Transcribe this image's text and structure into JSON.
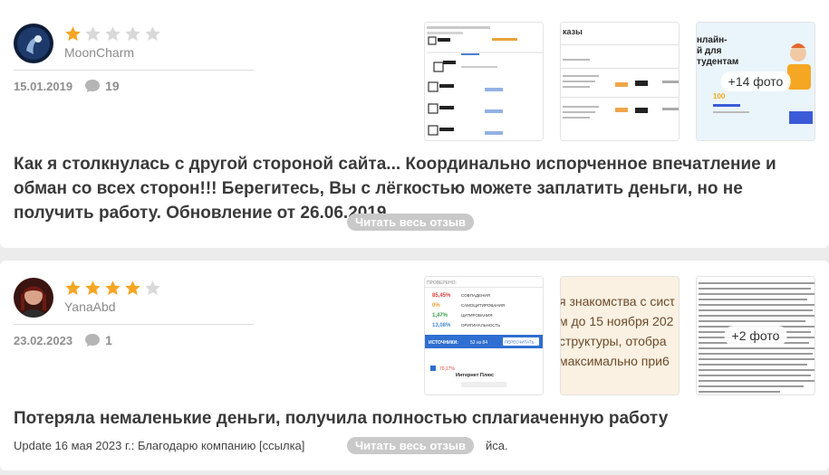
{
  "reviews": [
    {
      "username": "MoonCharm",
      "rating": 1,
      "date": "15.01.2019",
      "comments": "19",
      "photo_badge": "+14 фото",
      "title": "Как я столкнулась с другой стороной сайта... Координально испорченное впечатление и обман со всех сторон!!! Берегитесь, Вы с лёгкостью можете заплатить деньги, но не получить работу. Обновление от 26.06.2019",
      "read_more": "Читать весь отзыв",
      "thumb2_text": "казы",
      "thumb3_text": "нлайн- ... студентам",
      "avatar_icon": "user-avatar-dark"
    },
    {
      "username": "YanaAbd",
      "rating": 4,
      "date": "23.02.2023",
      "comments": "1",
      "photo_badge": "+2 фото",
      "title": "Потеряла немаленькие деньги, получила полностью сплагиаченную работу",
      "update": "Update 16 мая 2023 г.: Благодарю компанию [ссылка]",
      "update_tail": "йса.",
      "read_more": "Читать весь отзыв",
      "thumb1_stats": [
        "85,45%",
        "0%",
        "1,47%",
        "13,08%"
      ],
      "thumb1_labels": [
        "СОВПАДЕНИЯ",
        "САМОЦИТИРОВАНИЯ",
        "ЦИТИРОВАНИЯ",
        "ОРИГИНАЛЬНОСТЬ"
      ],
      "thumb1_bar": "ИСТОЧНИКИ:",
      "thumb1_bar_value": "52 из 84",
      "thumb1_button": "ПЕРЕСЧИТАТЬ",
      "thumb1_source": "Интернет Плюс",
      "thumb2_lines": [
        "я знакомства с сисτ",
        "м до 15 ноября 202",
        "структуры, отобра",
        "максимально при6"
      ],
      "avatar_icon": "user-avatar-photo"
    }
  ],
  "colors": {
    "star_on": "#f5a623",
    "star_off": "#d9d9d9",
    "read_more_bg": "#c9c9c9"
  }
}
